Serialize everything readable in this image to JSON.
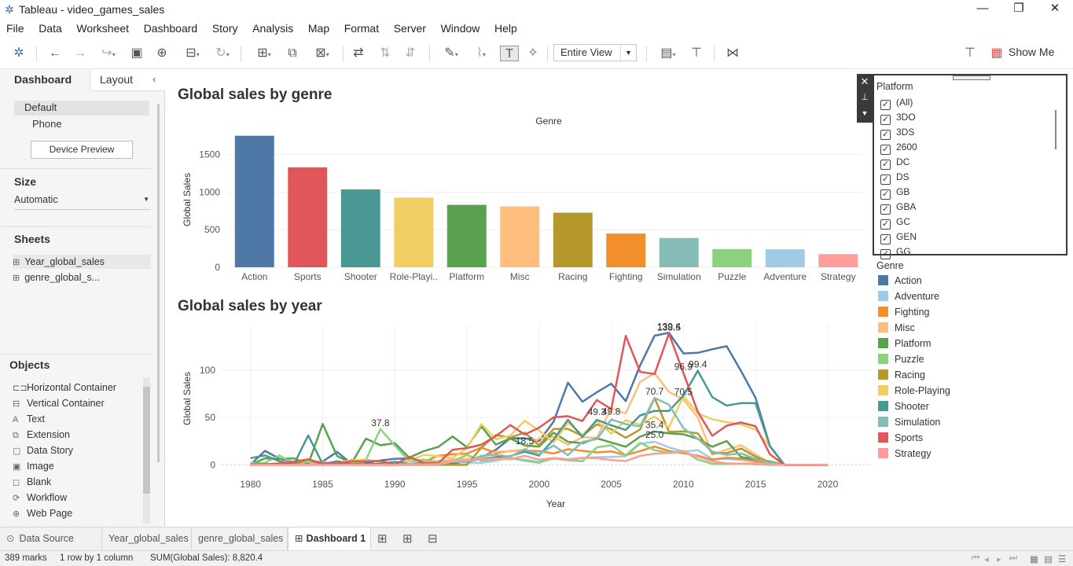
{
  "window": {
    "title": "Tableau - video_games_sales"
  },
  "menu": [
    "File",
    "Data",
    "Worksheet",
    "Dashboard",
    "Story",
    "Analysis",
    "Map",
    "Format",
    "Server",
    "Window",
    "Help"
  ],
  "toolbar": {
    "fit": "Entire View",
    "show_me": "Show Me"
  },
  "left_pane": {
    "tabs": [
      "Dashboard",
      "Layout"
    ],
    "devices": [
      "Default",
      "Phone"
    ],
    "device_preview": "Device Preview",
    "size_heading": "Size",
    "size_value": "Automatic",
    "sheets_heading": "Sheets",
    "sheets": [
      "Year_global_sales",
      "genre_global_s..."
    ],
    "objects_heading": "Objects",
    "objects": [
      "Horizontal Container",
      "Vertical Container",
      "Text",
      "Extension",
      "Data Story",
      "Image",
      "Blank",
      "Workflow",
      "Web Page"
    ]
  },
  "bar_chart": {
    "title": "Global sales by genre",
    "header": "Genre"
  },
  "line_chart": {
    "title": "Global sales by year"
  },
  "chart_data": [
    {
      "type": "bar",
      "title": "Global sales by genre",
      "xlabel": "Genre",
      "ylabel": "Global Sales",
      "ylim": [
        0,
        1800
      ],
      "yticks": [
        0,
        500,
        1000,
        1500
      ],
      "categories": [
        "Action",
        "Sports",
        "Shooter",
        "Role-Playi..",
        "Platform",
        "Misc",
        "Racing",
        "Fighting",
        "Simulation",
        "Puzzle",
        "Adventure",
        "Strategy"
      ],
      "values": [
        1751,
        1331,
        1037,
        927,
        831,
        810,
        727,
        449,
        390,
        243,
        240,
        175
      ],
      "colors": [
        "#4e79a7",
        "#e15759",
        "#499894",
        "#f1ce63",
        "#59a14f",
        "#ffbe7d",
        "#b6992d",
        "#f28e2b",
        "#86bcb6",
        "#8cd17d",
        "#a0cbe8",
        "#ff9d9a"
      ]
    },
    {
      "type": "line",
      "title": "Global sales by year",
      "xlabel": "Year",
      "ylabel": "Global Sales",
      "xlim": [
        1978,
        2023
      ],
      "ylim": [
        -8,
        148
      ],
      "xticks": [
        1980,
        1985,
        1990,
        1995,
        2000,
        2005,
        2010,
        2015,
        2020
      ],
      "yticks": [
        0,
        50,
        100
      ],
      "x": [
        1980,
        1981,
        1982,
        1983,
        1984,
        1985,
        1986,
        1987,
        1988,
        1989,
        1990,
        1991,
        1992,
        1993,
        1994,
        1995,
        1996,
        1997,
        1998,
        1999,
        2000,
        2001,
        2002,
        2003,
        2004,
        2005,
        2006,
        2007,
        2008,
        2009,
        2010,
        2011,
        2012,
        2013,
        2014,
        2015,
        2016,
        2017,
        2020
      ],
      "series": [
        {
          "name": "Action",
          "color": "#4e79a7",
          "values": [
            0.3,
            14.8,
            6.5,
            2.9,
            1.9,
            3.5,
            13.7,
            1.1,
            1.7,
            4.6,
            6.4,
            6.8,
            3.5,
            2.2,
            1.4,
            3.6,
            7.5,
            16.0,
            28.0,
            28.1,
            25.0,
            45.5,
            86.8,
            66.7,
            76.6,
            85.7,
            67.3,
            104.9,
            136.4,
            139.4,
            117.6,
            118.3,
            122.0,
            125.3,
            99.0,
            70.7,
            19.9,
            0,
            0
          ]
        },
        {
          "name": "Adventure",
          "color": "#a0cbe8",
          "values": [
            0,
            0,
            1.2,
            0.4,
            0,
            0,
            0.8,
            0,
            0,
            0,
            0,
            0.4,
            0,
            0.4,
            3.7,
            2.3,
            2.1,
            4.3,
            7.8,
            4.1,
            2.0,
            7.3,
            6.0,
            7.5,
            8.2,
            8.4,
            9.1,
            22.3,
            24.4,
            18.5,
            14.1,
            15.5,
            6.3,
            6.2,
            5.3,
            3.7,
            1.4,
            0,
            0
          ]
        },
        {
          "name": "Fighting",
          "color": "#f28e2b",
          "values": [
            0.8,
            0,
            0,
            0,
            0,
            1.0,
            0,
            5.4,
            0,
            0,
            0,
            0.4,
            3.0,
            9.7,
            11.2,
            11.9,
            18.3,
            12.5,
            14.7,
            15.1,
            14.5,
            12.0,
            16.6,
            14.8,
            13.2,
            14.2,
            10.3,
            14.6,
            19.4,
            14.7,
            12.2,
            9.8,
            5.4,
            7.7,
            6.6,
            4.0,
            1.7,
            0,
            0
          ]
        },
        {
          "name": "Misc",
          "color": "#ffbe7d",
          "values": [
            2.7,
            0,
            1.9,
            0,
            1.5,
            0,
            1.3,
            0,
            0,
            1.3,
            1.7,
            4.1,
            3.3,
            4.1,
            5.8,
            6.3,
            7.0,
            14.0,
            14.5,
            16.2,
            28.0,
            29.8,
            21.4,
            29.1,
            28.6,
            59.6,
            54.4,
            87.5,
            96.9,
            77.0,
            69.0,
            50.2,
            10.8,
            16.2,
            20.8,
            11.1,
            1.8,
            0,
            0
          ]
        },
        {
          "name": "Platform",
          "color": "#59a14f",
          "values": [
            0,
            6.9,
            6.2,
            6.9,
            0.7,
            43.2,
            9.4,
            1.7,
            27.7,
            20.7,
            22.9,
            7.6,
            14.5,
            18.9,
            30.0,
            18.6,
            40.8,
            21.4,
            27.9,
            20.6,
            19.3,
            34.0,
            24.4,
            22.9,
            28.1,
            23.6,
            19.1,
            29.8,
            35.2,
            33.2,
            32.3,
            27.5,
            19.1,
            25.2,
            8.2,
            6.1,
            3.5,
            0,
            0
          ]
        },
        {
          "name": "Puzzle",
          "color": "#8cd17d",
          "values": [
            1.1,
            2.2,
            10.0,
            0.8,
            3.2,
            3.2,
            0,
            1.5,
            5.6,
            37.8,
            20.4,
            3.9,
            5.6,
            3.1,
            3.6,
            10.6,
            4.4,
            6.1,
            6.6,
            5.3,
            3.0,
            6.6,
            4.9,
            3.8,
            18.5,
            20.8,
            10.1,
            23.3,
            15.5,
            12.9,
            14.6,
            5.6,
            1.1,
            1.0,
            1.5,
            0.7,
            0,
            0,
            0
          ]
        },
        {
          "name": "Racing",
          "color": "#b6992d",
          "values": [
            0,
            0.5,
            1.6,
            0,
            5.9,
            0,
            2.0,
            0,
            0,
            0,
            0,
            0,
            0,
            0,
            0,
            0,
            18.2,
            31.5,
            28.9,
            34.0,
            20.7,
            38.0,
            38.0,
            30.6,
            42.7,
            37.6,
            28.7,
            37.3,
            70.7,
            34.8,
            35.4,
            33.2,
            12.3,
            12.5,
            17.2,
            8.7,
            2.8,
            0,
            0
          ]
        },
        {
          "name": "Role-Playing",
          "color": "#f1ce63",
          "values": [
            0,
            0,
            0,
            0,
            0,
            0,
            2.5,
            4.6,
            5.9,
            2.2,
            1.9,
            4.3,
            10.6,
            9.3,
            7.2,
            17.6,
            43.2,
            27.0,
            30.9,
            46.5,
            36.4,
            23.5,
            44.4,
            31.6,
            46.3,
            33.1,
            47.1,
            42.4,
            51.2,
            39.4,
            72.7,
            54.4,
            48.1,
            45.1,
            42.7,
            37.3,
            19.2,
            0,
            0
          ]
        },
        {
          "name": "Shooter",
          "color": "#499894",
          "values": [
            7.1,
            10.0,
            3.9,
            0.5,
            31.1,
            1.0,
            3.9,
            0.7,
            0.3,
            1.3,
            3.2,
            1.1,
            1.8,
            0.4,
            3.3,
            3.6,
            6.3,
            8.2,
            9.3,
            13.9,
            9.8,
            26.8,
            47.6,
            29.4,
            47.6,
            41.8,
            36.9,
            52.2,
            57.0,
            57.0,
            73.2,
            99.4,
            71.5,
            62.6,
            65.2,
            65.1,
            19.6,
            0,
            0
          ]
        },
        {
          "name": "Simulation",
          "color": "#86bcb6",
          "values": [
            0,
            0.4,
            0,
            0,
            0,
            0,
            0,
            0,
            0.2,
            0,
            1.4,
            0,
            0.5,
            0.1,
            3.2,
            3.1,
            9.6,
            10.7,
            8.6,
            16.4,
            11.2,
            20.5,
            10.3,
            24.3,
            27.2,
            47.9,
            43.0,
            40.6,
            70.7,
            63.5,
            38.8,
            27.5,
            14.0,
            10.6,
            12.2,
            6.2,
            2.2,
            0,
            0
          ]
        },
        {
          "name": "Sports",
          "color": "#e15759",
          "values": [
            0.5,
            0.8,
            1.1,
            3.3,
            5.9,
            1.5,
            1.5,
            3.7,
            3.9,
            4.2,
            0.4,
            8.4,
            2.2,
            1.6,
            16.0,
            17.7,
            21.4,
            30.3,
            42.0,
            32.0,
            39.3,
            50.2,
            51.4,
            46.3,
            68.5,
            58.9,
            136.2,
            98.2,
            95.9,
            138.5,
            96.9,
            56.1,
            30.7,
            41.4,
            44.8,
            40.8,
            11.2,
            0,
            0
          ]
        },
        {
          "name": "Strategy",
          "color": "#ff9d9a",
          "values": [
            0,
            0,
            0,
            0,
            0,
            0,
            0,
            0,
            0,
            0,
            0,
            0.9,
            0.4,
            0.8,
            4.0,
            4.9,
            6.1,
            6.8,
            6.2,
            9.4,
            5.5,
            7.3,
            5.6,
            7.0,
            7.1,
            5.0,
            4.1,
            9.5,
            11.8,
            12.4,
            13.8,
            8.7,
            3.6,
            1.6,
            1.4,
            1.8,
            0.8,
            0,
            0
          ]
        }
      ],
      "annotations": [
        {
          "x": 1989,
          "y": 37.8,
          "text": "37.8"
        },
        {
          "x": 1999,
          "y": 18.5,
          "text": "18.5"
        },
        {
          "x": 2004,
          "y": 49.3,
          "text": "49.3"
        },
        {
          "x": 2005,
          "y": 49.8,
          "text": "49.8"
        },
        {
          "x": 2008,
          "y": 70.7,
          "text": "70.7"
        },
        {
          "x": 2008,
          "y": 35.4,
          "text": "35.4"
        },
        {
          "x": 2008,
          "y": 25.0,
          "text": "25.0"
        },
        {
          "x": 2009,
          "y": 138.5,
          "text": "138.5"
        },
        {
          "x": 2009,
          "y": 139.4,
          "text": "139.4"
        },
        {
          "x": 2010,
          "y": 96.9,
          "text": "96.9"
        },
        {
          "x": 2010,
          "y": 70.5,
          "text": "70.5"
        },
        {
          "x": 2011,
          "y": 99.4,
          "text": "99.4"
        }
      ]
    }
  ],
  "filter": {
    "title": "Platform",
    "items": [
      "(All)",
      "3DO",
      "3DS",
      "2600",
      "DC",
      "DS",
      "GB",
      "GBA",
      "GC",
      "GEN",
      "GG"
    ]
  },
  "legend": {
    "title": "Genre"
  },
  "bottom_tabs": [
    "Data Source",
    "Year_global_sales",
    "genre_global_sales",
    "Dashboard 1"
  ],
  "status": {
    "marks": "389 marks",
    "rows": "1 row by 1 column",
    "sum": "SUM(Global Sales): 8,820.4"
  }
}
